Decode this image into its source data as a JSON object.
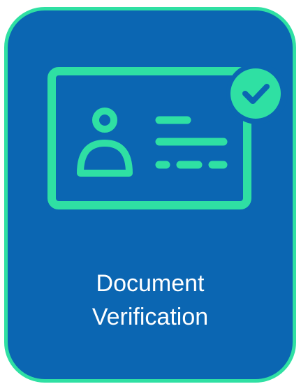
{
  "tile": {
    "title_line1": "Document",
    "title_line2": "Verification",
    "icon": "id-card-verified-icon",
    "badge_icon": "check-badge-icon",
    "colors": {
      "background": "#0b66b2",
      "accent": "#2fe0a3",
      "text": "#ffffff"
    }
  }
}
